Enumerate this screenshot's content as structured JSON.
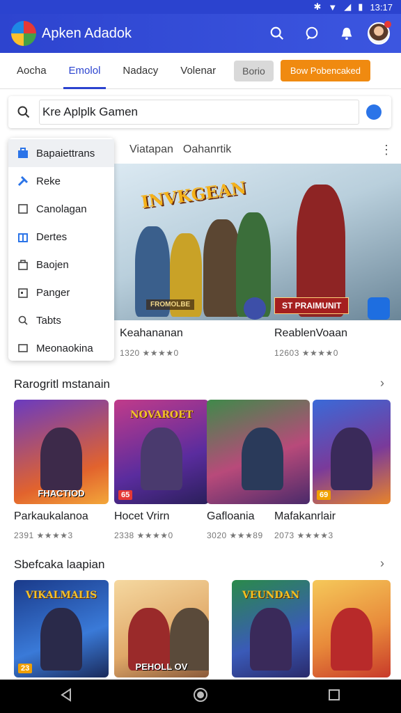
{
  "status": {
    "time": "13:17"
  },
  "header": {
    "title": "Apken Adadok"
  },
  "tabs": {
    "items": [
      "Aocha",
      "Emolol",
      "Nadacy",
      "Volenar"
    ],
    "active": 1,
    "gray_button": "Borio",
    "orange_button": "Bow Pobencaked"
  },
  "search": {
    "value": "Kre Aplplk Gamen"
  },
  "menu": {
    "items": [
      "Bapaiettrans",
      "Reke",
      "Canolagan",
      "Dertes",
      "Baojen",
      "Panger",
      "Tabts",
      "Meonaokina"
    ]
  },
  "featured": {
    "head_a": "Viatapan",
    "head_b": "Oahanrtik",
    "banner_title": "INVKGEAN",
    "banner_subtitle": "FROMOLBE",
    "banner_badge": "ST PRAIMUNIT",
    "items": [
      {
        "title": "Keahananan",
        "meta": "1320 ★★★★0"
      },
      {
        "title": "ReablenVoaan",
        "meta": "12603 ★★★★0"
      }
    ]
  },
  "section1": {
    "title": "Rarogritl mstanain",
    "cards": [
      {
        "title": "Parkaukalanoa",
        "meta": "2391 ★★★★3",
        "label": "FHACTIOD",
        "top": "",
        "num": ""
      },
      {
        "title": "Hocet Vrirn",
        "meta": "2338 ★★★★0",
        "label": "",
        "top": "NOVAROET",
        "num": "65"
      },
      {
        "title": "Gafloania",
        "meta": "3020 ★★★89",
        "label": "",
        "top": "",
        "num": ""
      },
      {
        "title": "Mafakanrlair",
        "meta": "2073 ★★★★3",
        "label": "",
        "top": "",
        "num": "69"
      }
    ]
  },
  "section2": {
    "title": "Sbefcaka laapian",
    "cards": [
      {
        "top": "VIKALMALIS",
        "label": "",
        "num": "23"
      },
      {
        "top": "",
        "label": "PEHOLL OV",
        "num": ""
      },
      {
        "top": "VEUNDAN",
        "label": "",
        "num": ""
      },
      {
        "top": "",
        "label": "",
        "num": ""
      }
    ]
  },
  "colors": {
    "primary": "#2b43cf",
    "accent": "#f08a10"
  }
}
